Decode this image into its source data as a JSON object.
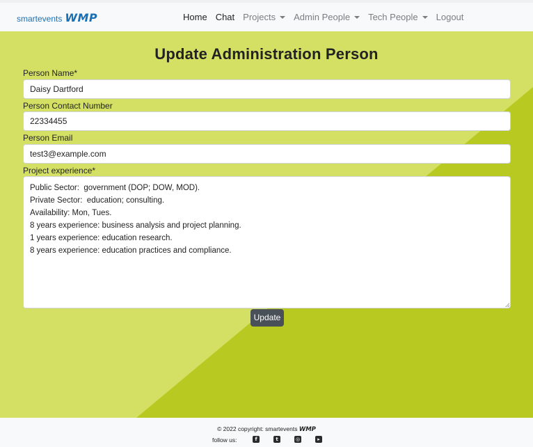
{
  "nav": {
    "brand_text": "smartevents",
    "brand_logo": "WMP",
    "items": [
      {
        "label": "Home",
        "icon": ""
      },
      {
        "label": "Chat",
        "icon": ""
      },
      {
        "label": "Projects",
        "icon": "caret-down-icon"
      },
      {
        "label": "Admin People",
        "icon": "caret-down-icon"
      },
      {
        "label": "Tech People",
        "icon": "caret-down-icon"
      },
      {
        "label": "Logout",
        "icon": ""
      }
    ]
  },
  "form": {
    "title": "Update Administration Person",
    "name_label": "Person Name*",
    "name_value": "Daisy Dartford",
    "contact_label": "Person Contact Number",
    "contact_value": "22334455",
    "email_label": "Person Email",
    "email_value": "test3@example.com",
    "experience_label": "Project experience*",
    "experience_lines": [
      "Public Sector:  government (DOP; DOW, MOD).",
      "Private Sector:  education; consulting.",
      "Availability: Mon, Tues.",
      "8 years experience: business analysis and project planning.",
      "1 years experience: education research.",
      "8 years experience: education practices and compliance."
    ],
    "update_label": "Update"
  },
  "footer": {
    "copyright": "© 2022 copyright: smartevents",
    "copyright_logo": "WMP",
    "follow_label": "follow us:",
    "social_icons": [
      "facebook-icon",
      "twitter-icon",
      "instagram-icon",
      "youtube-icon"
    ]
  },
  "colors": {
    "background": "#d4e064",
    "background_dark": "#b8c922",
    "button": "#495057",
    "brand": "#1b6fb3"
  }
}
